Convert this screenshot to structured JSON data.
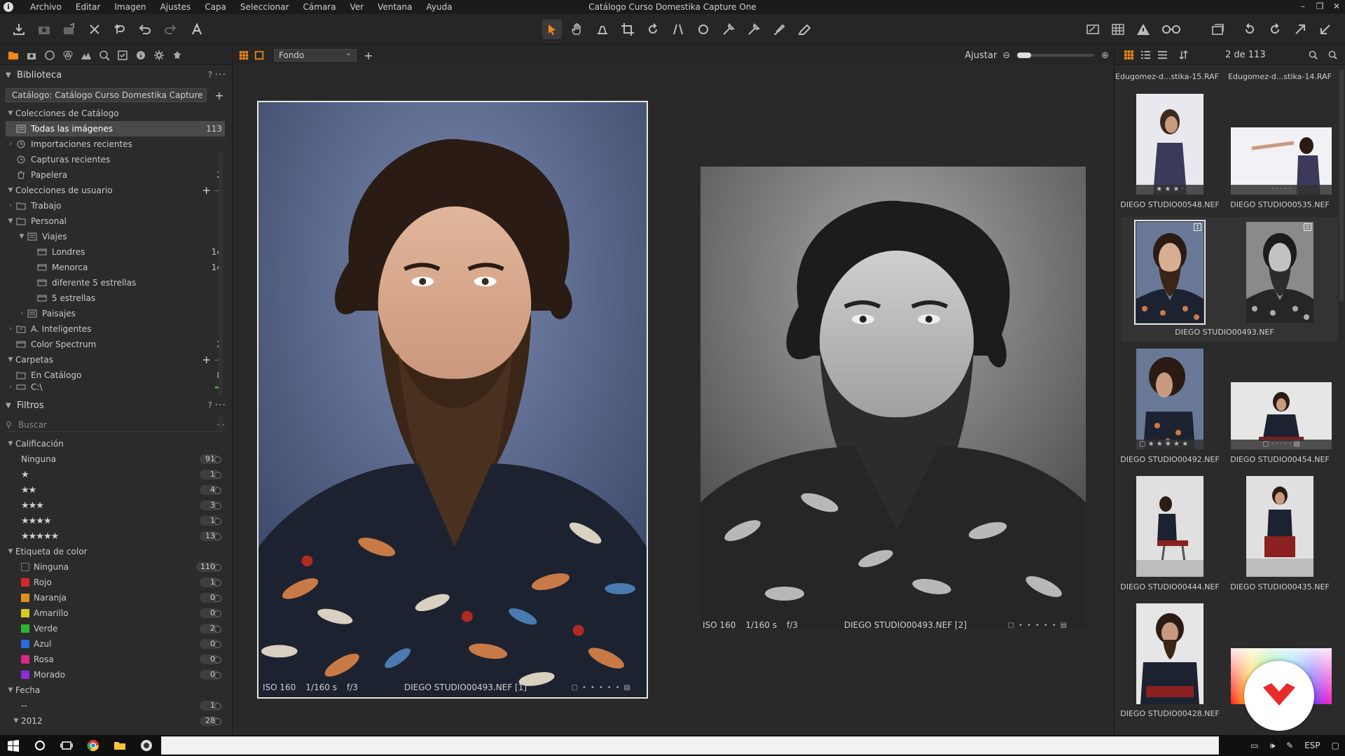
{
  "window": {
    "title": "Catálogo Curso Domestika Capture One",
    "menu": [
      "Archivo",
      "Editar",
      "Imagen",
      "Ajustes",
      "Capa",
      "Seleccionar",
      "Cámara",
      "Ver",
      "Ventana",
      "Ayuda"
    ]
  },
  "library": {
    "title": "Biblioteca",
    "help": "?",
    "catalog_selector": "Catálogo: Catálogo Curso Domestika Capture C",
    "catalog_collections": "Colecciones de Catálogo",
    "items": [
      {
        "label": "Todas las imágenes",
        "count": "113"
      },
      {
        "label": "Importaciones recientes",
        "count": ""
      },
      {
        "label": "Capturas recientes",
        "count": ""
      },
      {
        "label": "Papelera",
        "count": "2"
      }
    ],
    "user_collections": "Colecciones de usuario",
    "user_items": [
      {
        "label": "Trabajo",
        "count": ""
      },
      {
        "label": "Personal",
        "count": ""
      },
      {
        "label": "Viajes",
        "count": ""
      },
      {
        "label": "Londres",
        "count": "14"
      },
      {
        "label": "Menorca",
        "count": "14"
      },
      {
        "label": "diferente 5 estrellas",
        "count": ""
      },
      {
        "label": "5 estrellas",
        "count": ""
      },
      {
        "label": "Paisajes",
        "count": ""
      },
      {
        "label": "A. Inteligentes",
        "count": ""
      },
      {
        "label": "Color Spectrum",
        "count": "2"
      }
    ],
    "folders": "Carpetas",
    "folder_items": [
      {
        "label": "En Catálogo",
        "count": "8"
      },
      {
        "label": "C:\\",
        "count": ""
      }
    ]
  },
  "filters": {
    "title": "Filtros",
    "help": "?",
    "search_placeholder": "Buscar",
    "rating_header": "Calificación",
    "ratings": [
      {
        "label": "Ninguna",
        "count": "91"
      },
      {
        "label": "★",
        "count": "1"
      },
      {
        "label": "★★",
        "count": "4"
      },
      {
        "label": "★★★",
        "count": "3"
      },
      {
        "label": "★★★★",
        "count": "1"
      },
      {
        "label": "★★★★★",
        "count": "13"
      }
    ],
    "color_header": "Etiqueta de color",
    "colors": [
      {
        "label": "Ninguna",
        "count": "110",
        "color": "#2b2b2b"
      },
      {
        "label": "Rojo",
        "count": "1",
        "color": "#d62828"
      },
      {
        "label": "Naranja",
        "count": "0",
        "color": "#e0901c"
      },
      {
        "label": "Amarillo",
        "count": "0",
        "color": "#d8c81e"
      },
      {
        "label": "Verde",
        "count": "2",
        "color": "#2eb432"
      },
      {
        "label": "Azul",
        "count": "0",
        "color": "#2a6cd8"
      },
      {
        "label": "Rosa",
        "count": "0",
        "color": "#d8288a"
      },
      {
        "label": "Morado",
        "count": "0",
        "color": "#8a2ad8"
      }
    ],
    "date_header": "Fecha",
    "dates": [
      {
        "label": "--",
        "count": "1"
      },
      {
        "label": "2012",
        "count": "28"
      }
    ]
  },
  "viewer": {
    "background_select": "Fondo",
    "fit_label": "Ajustar",
    "photo1": {
      "iso": "ISO 160",
      "shutter": "1/160 s",
      "aperture": "f/3",
      "name": "DIEGO STUDIO00493.NEF [1]"
    },
    "photo2": {
      "iso": "ISO 160",
      "shutter": "1/160 s",
      "aperture": "f/3",
      "name": "DIEGO STUDIO00493.NEF [2]"
    }
  },
  "browser": {
    "counter": "2 de 113",
    "top_labels": [
      "Edugomez-d...stika-15.RAF",
      "Edugomez-d...stika-14.RAF"
    ],
    "thumbs": [
      {
        "name": "DIEGO STUDIO00548.NEF"
      },
      {
        "name": "DIEGO STUDIO00535.NEF"
      },
      {
        "name": "DIEGO STUDIO00493.NEF"
      },
      {
        "name": "DIEGO STUDIO00492.NEF"
      },
      {
        "name": "DIEGO STUDIO00454.NEF"
      },
      {
        "name": "DIEGO STUDIO00444.NEF"
      },
      {
        "name": "DIEGO STUDIO00435.NEF"
      },
      {
        "name": "DIEGO STUDIO00428.NEF"
      }
    ],
    "variant_badges": [
      "1",
      "2"
    ]
  },
  "taskbar": {
    "lang": "ESP"
  }
}
